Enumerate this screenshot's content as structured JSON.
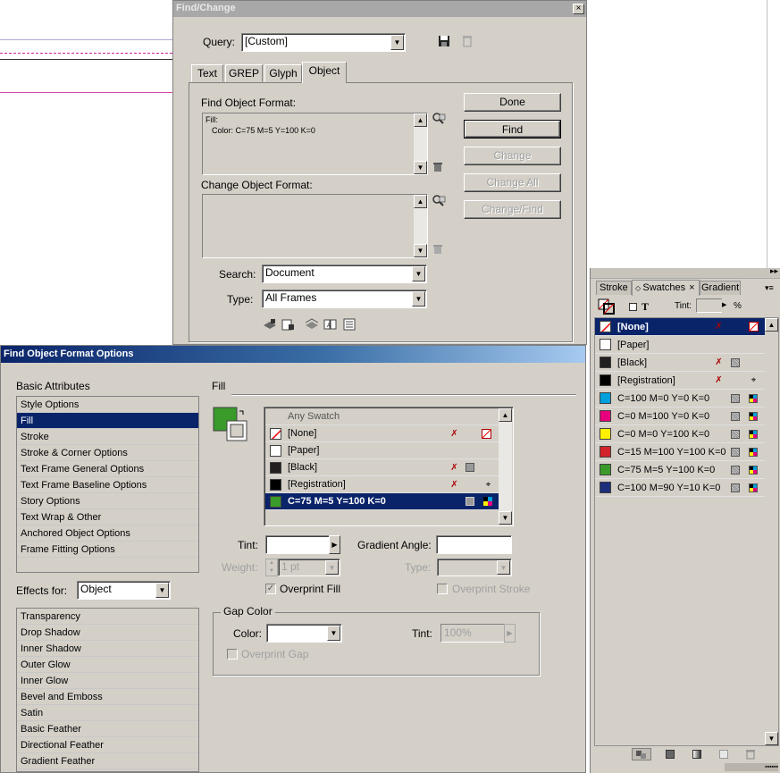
{
  "find_change": {
    "title": "Find/Change",
    "query_label": "Query:",
    "query_value": "[Custom]",
    "tabs": [
      "Text",
      "GREP",
      "Glyph",
      "Object"
    ],
    "find_format_label": "Find Object Format:",
    "find_format_text_line1": "Fill:",
    "find_format_text_line2": "Color: C=75 M=5 Y=100 K=0",
    "change_format_label": "Change Object Format:",
    "search_label": "Search:",
    "search_value": "Document",
    "type_label": "Type:",
    "type_value": "All Frames",
    "buttons": {
      "done": "Done",
      "find": "Find",
      "change": "Change",
      "change_all": "Change All",
      "change_find": "Change/Find"
    }
  },
  "options_dialog": {
    "title": "Find Object Format Options",
    "basic_attributes_label": "Basic Attributes",
    "basic_attributes": [
      "Style Options",
      "Fill",
      "Stroke",
      "Stroke & Corner Options",
      "Text Frame General Options",
      "Text Frame Baseline Options",
      "Story Options",
      "Text Wrap & Other",
      "Anchored Object Options",
      "Frame Fitting Options"
    ],
    "selected_attribute": "Fill",
    "effects_for_label": "Effects for:",
    "effects_for_value": "Object",
    "effects": [
      "Transparency",
      "Drop Shadow",
      "Inner Shadow",
      "Outer Glow",
      "Inner Glow",
      "Bevel and Emboss",
      "Satin",
      "Basic Feather",
      "Directional Feather",
      "Gradient Feather"
    ],
    "fill_section_label": "Fill",
    "swatch_list": [
      {
        "name": "Any Swatch",
        "color": "none"
      },
      {
        "name": "[None]",
        "color": "none-slash"
      },
      {
        "name": "[Paper]",
        "color": "#ffffff"
      },
      {
        "name": "[Black]",
        "color": "#231f20"
      },
      {
        "name": "[Registration]",
        "color": "#000000"
      },
      {
        "name": "C=75 M=5 Y=100 K=0",
        "color": "#3a9a2a"
      }
    ],
    "selected_swatch": "C=75 M=5 Y=100 K=0",
    "tint_label": "Tint:",
    "gradient_angle_label": "Gradient Angle:",
    "weight_label": "Weight:",
    "weight_value": "1 pt",
    "type_label": "Type:",
    "overprint_fill": "Overprint Fill",
    "overprint_stroke": "Overprint Stroke",
    "gap_color_label": "Gap Color",
    "color_label": "Color:",
    "gap_tint_label": "Tint:",
    "gap_tint_value": "100%",
    "overprint_gap": "Overprint Gap",
    "fill_color": "#3a9a2a"
  },
  "swatches_panel": {
    "tabs": [
      "Stroke",
      "Swatches",
      "Gradient"
    ],
    "tint_label": "Tint:",
    "percent": "%",
    "swatches": [
      {
        "name": "[None]",
        "color": "none-slash"
      },
      {
        "name": "[Paper]",
        "color": "#ffffff"
      },
      {
        "name": "[Black]",
        "color": "#231f20"
      },
      {
        "name": "[Registration]",
        "color": "#000000"
      },
      {
        "name": "C=100 M=0 Y=0 K=0",
        "color": "#00a0dc"
      },
      {
        "name": "C=0 M=100 Y=0 K=0",
        "color": "#e6007e"
      },
      {
        "name": "C=0 M=0 Y=100 K=0",
        "color": "#fff100"
      },
      {
        "name": "C=15 M=100 Y=100 K=0",
        "color": "#d2232a"
      },
      {
        "name": "C=75 M=5 Y=100 K=0",
        "color": "#3a9a2a"
      },
      {
        "name": "C=100 M=90 Y=10 K=0",
        "color": "#1d2f7a"
      }
    ]
  }
}
